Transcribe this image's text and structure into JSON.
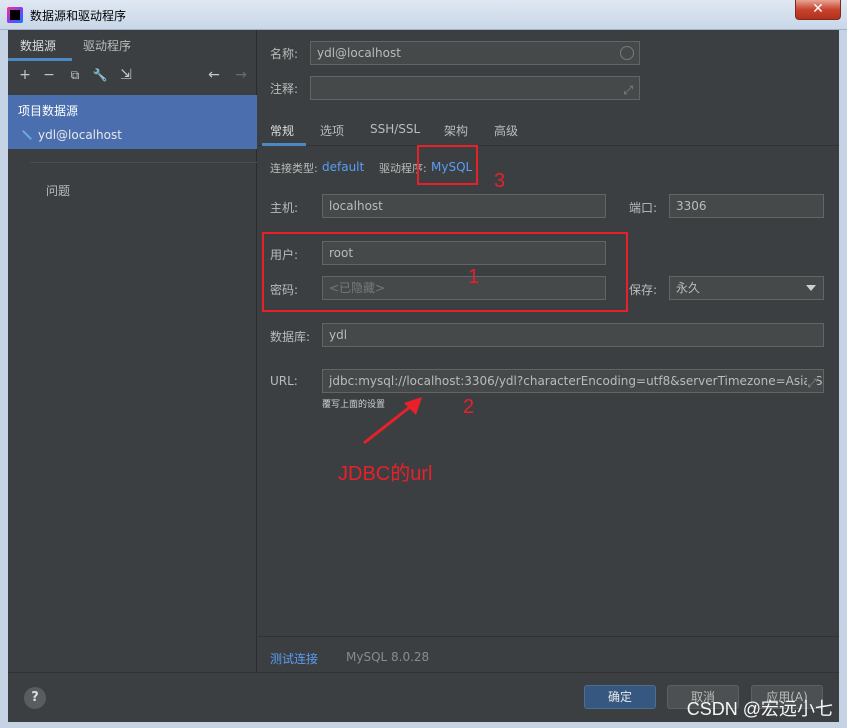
{
  "window": {
    "title": "数据源和驱动程序",
    "close_label": "✕"
  },
  "left": {
    "tabs": [
      {
        "label": "数据源"
      },
      {
        "label": "驱动程序"
      }
    ],
    "toolbar": {
      "add": "+",
      "remove": "−",
      "duplicate": "⧉",
      "settings": "🔧",
      "import": "⇲",
      "back": "←",
      "forward": "→"
    },
    "group_label": "项目数据源",
    "datasource": "ydl@localhost",
    "problems": "问题"
  },
  "right": {
    "name_label": "名称:",
    "name_value": "ydl@localhost",
    "comment_label": "注释:",
    "comment_value": "",
    "tabs": [
      {
        "label": "常规"
      },
      {
        "label": "选项"
      },
      {
        "label": "SSH/SSL"
      },
      {
        "label": "架构"
      },
      {
        "label": "高级"
      }
    ],
    "conn_type_label": "连接类型:",
    "conn_type_value": "default",
    "driver_label": "驱动程序:",
    "driver_value": "MySQL",
    "host_label": "主机:",
    "host_value": "localhost",
    "port_label": "端口:",
    "port_value": "3306",
    "user_label": "用户:",
    "user_value": "root",
    "password_label": "密码:",
    "password_placeholder": "<已隐藏>",
    "save_label": "保存:",
    "save_value": "永久",
    "database_label": "数据库:",
    "database_value": "ydl",
    "url_label": "URL:",
    "url_value": "jdbc:mysql://localhost:3306/ydl?characterEncoding=utf8&serverTimezone=Asia/Sl",
    "url_hint": "覆写上面的设置",
    "test_connection": "测试连接",
    "driver_version": "MySQL 8.0.28"
  },
  "bottom": {
    "help": "?",
    "ok": "确定",
    "cancel": "取消",
    "apply": "应用(A)"
  },
  "annotations": {
    "box1_num": "1",
    "box2_num": "2",
    "box3_num": "3",
    "jdbc_text": "JDBC的url"
  },
  "watermark": "CSDN @宏远小七",
  "colors": {
    "accent": "#4a88c7",
    "selection": "#4b6eaf",
    "link": "#589df6",
    "annotation": "#e8202a",
    "background": "#3c3f41"
  }
}
